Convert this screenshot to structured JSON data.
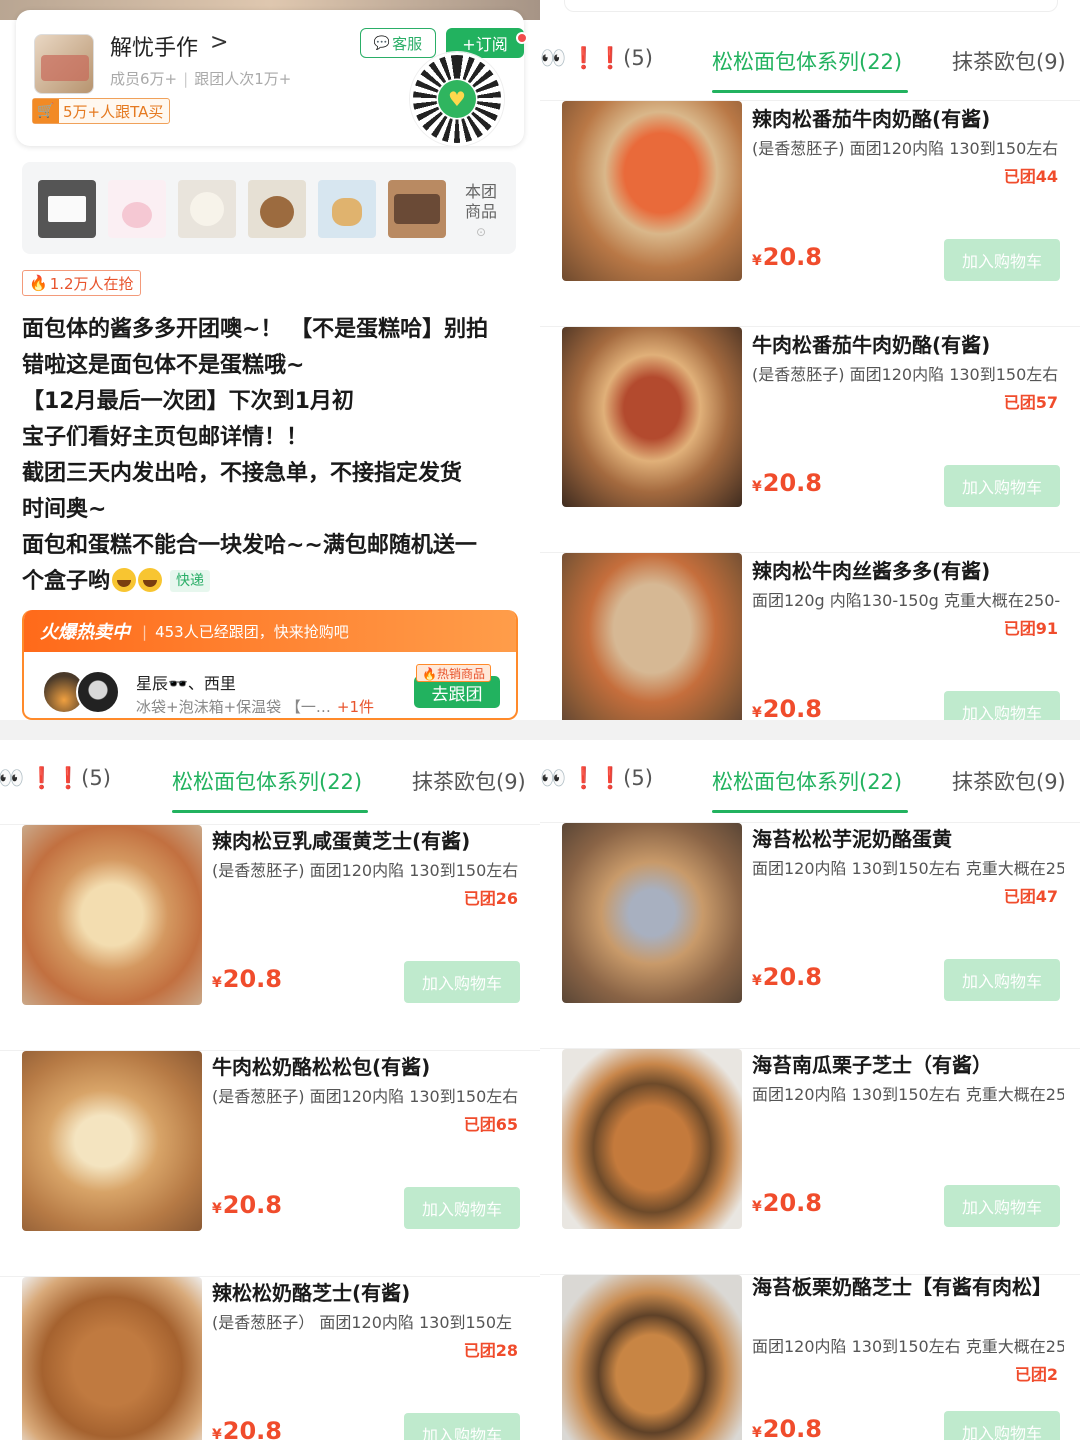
{
  "header": {
    "shop_name": "解忧手作",
    "shop_arrow": ">",
    "members": "成员6万+",
    "follows": "跟团人次1万+",
    "follow_badge": "5万+人跟TA买",
    "kefu": "客服",
    "subscribe": "+订阅",
    "team_goods": "本团商品"
  },
  "hot_count": "1.2万人在抢",
  "description": [
    "面包体的酱多多开团噢~！ 【不是蛋糕哈】别拍",
    "错啦这是面包体不是蛋糕哦~",
    "【12月最后一次团】下次到1月初",
    "宝子们看好主页包邮详情！！",
    "截团三天内发出哈，不接急单，不接指定发货",
    "时间奥~",
    "面包和蛋糕不能合一块发哈~~满包邮随机送一",
    "个盒子哟"
  ],
  "kuaidi_tag": "快递",
  "hot_panel": {
    "title": "火爆热卖中",
    "subtitle": "453人已经跟团，快来抢购吧",
    "buyer_names": "星辰🕶️、西里",
    "buyer_items": "冰袋+泡沫箱+保温袋 【一…",
    "more": "+1件",
    "go_tag": "🔥热销商品",
    "go_button": "去跟团"
  },
  "tabs": {
    "first": "❗❗(5)",
    "active": "松松面包体系列(22)",
    "third": "抹茶欧包(9)"
  },
  "cart_label": "加入购物车",
  "currency": "¥",
  "products_right_top": [
    {
      "title": "辣肉松番茄牛肉奶酪(有酱)",
      "sub": "(是香葱胚子) 面团120内陷 130到150左右",
      "sold": "已团44",
      "price": "20.8"
    },
    {
      "title": "牛肉松番茄牛肉奶酪(有酱)",
      "sub": "(是香葱胚子) 面团120内陷 130到150左右",
      "sold": "已团57",
      "price": "20.8"
    },
    {
      "title": "辣肉松牛肉丝酱多多(有酱)",
      "sub": "面团120g 内陷130-150g 克重大概在250-",
      "sold": "已团91",
      "price": "20.8"
    }
  ],
  "products_left_bottom": [
    {
      "title": "辣肉松豆乳咸蛋黄芝士(有酱)",
      "sub": "(是香葱胚子) 面团120内陷 130到150左右",
      "sold": "已团26",
      "price": "20.8"
    },
    {
      "title": "牛肉松奶酪松松包(有酱)",
      "sub": "(是香葱胚子) 面团120内陷 130到150左右",
      "sold": "已团65",
      "price": "20.8"
    },
    {
      "title": "辣松松奶酪芝士(有酱)",
      "sub": "(是香葱胚子） 面团120内陷 130到150左",
      "sold": "已团28",
      "price": "20.8"
    }
  ],
  "products_right_bottom": [
    {
      "title": "海苔松松芋泥奶酪蛋黄",
      "sub": "面团120内陷 130到150左右 克重大概在25",
      "sold": "已团47",
      "price": "20.8"
    },
    {
      "title": "海苔南瓜栗子芝士（有酱）",
      "sub": "面团120内陷 130到150左右 克重大概在25",
      "sold": "",
      "price": "20.8"
    },
    {
      "title": "海苔板栗奶酪芝士【有酱有肉松】",
      "sub": "面团120内陷 130到150左右 克重大概在25",
      "sold": "已团2",
      "price": "20.8"
    }
  ]
}
